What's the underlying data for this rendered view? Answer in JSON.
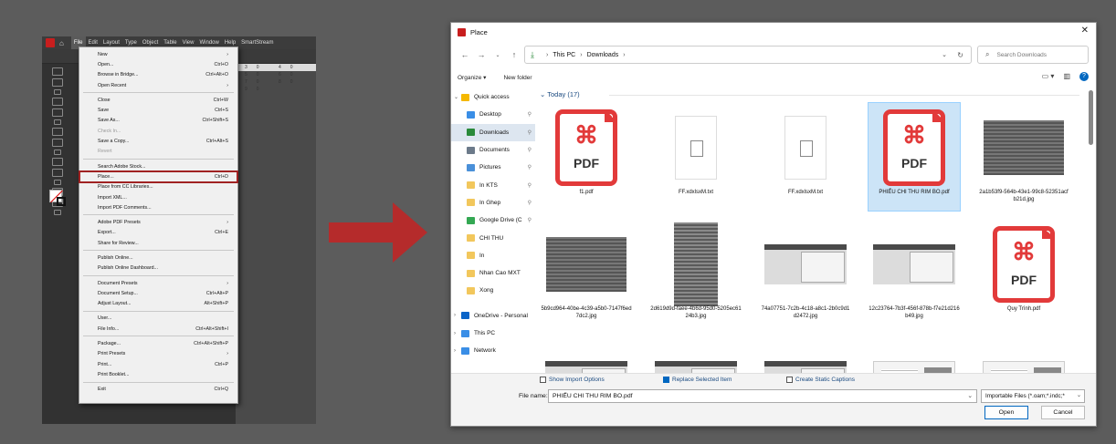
{
  "indesign": {
    "menubar": [
      "File",
      "Edit",
      "Layout",
      "Type",
      "Object",
      "Table",
      "View",
      "Window",
      "Help",
      "SmartStream"
    ],
    "ruler_ticks": "30 40 50 60 70 80 90",
    "file_menu": [
      {
        "label": "New",
        "shortcut": "",
        "sub": true
      },
      {
        "label": "Open...",
        "shortcut": "Ctrl+O"
      },
      {
        "label": "Browse in Bridge...",
        "shortcut": "Ctrl+Alt+O"
      },
      {
        "label": "Open Recent",
        "shortcut": "",
        "sub": true
      },
      {
        "sep": true
      },
      {
        "label": "Close",
        "shortcut": "Ctrl+W"
      },
      {
        "label": "Save",
        "shortcut": "Ctrl+S"
      },
      {
        "label": "Save As...",
        "shortcut": "Ctrl+Shift+S"
      },
      {
        "label": "Check In...",
        "shortcut": "",
        "disabled": true
      },
      {
        "label": "Save a Copy...",
        "shortcut": "Ctrl+Alt+S"
      },
      {
        "label": "Revert",
        "shortcut": "",
        "disabled": true
      },
      {
        "sep": true
      },
      {
        "label": "Search Adobe Stock...",
        "shortcut": ""
      },
      {
        "label": "Place...",
        "shortcut": "Ctrl+D",
        "highlight": true
      },
      {
        "label": "Place from CC Libraries...",
        "shortcut": ""
      },
      {
        "label": "Import XML...",
        "shortcut": ""
      },
      {
        "label": "Import PDF Comments...",
        "shortcut": ""
      },
      {
        "sep": true
      },
      {
        "label": "Adobe PDF Presets",
        "shortcut": "",
        "sub": true
      },
      {
        "label": "Export...",
        "shortcut": "Ctrl+E"
      },
      {
        "label": "Share for Review...",
        "shortcut": ""
      },
      {
        "sep": true
      },
      {
        "label": "Publish Online...",
        "shortcut": ""
      },
      {
        "label": "Publish Online Dashboard...",
        "shortcut": ""
      },
      {
        "sep": true
      },
      {
        "label": "Document Presets",
        "shortcut": "",
        "sub": true
      },
      {
        "label": "Document Setup...",
        "shortcut": "Ctrl+Alt+P"
      },
      {
        "label": "Adjust Layout...",
        "shortcut": "Alt+Shift+P"
      },
      {
        "sep": true
      },
      {
        "label": "User...",
        "shortcut": ""
      },
      {
        "label": "File Info...",
        "shortcut": "Ctrl+Alt+Shift+I"
      },
      {
        "sep": true
      },
      {
        "label": "Package...",
        "shortcut": "Ctrl+Alt+Shift+P"
      },
      {
        "label": "Print Presets",
        "shortcut": "",
        "sub": true
      },
      {
        "label": "Print...",
        "shortcut": "Ctrl+P"
      },
      {
        "label": "Print Booklet...",
        "shortcut": ""
      },
      {
        "sep": true
      },
      {
        "label": "Exit",
        "shortcut": "Ctrl+Q"
      }
    ]
  },
  "dialog": {
    "title": "Place",
    "breadcrumb": [
      "This PC",
      "Downloads"
    ],
    "search_placeholder": "Search Downloads",
    "organize": "Organize ▾",
    "new_folder": "New folder",
    "nav": [
      {
        "label": "Quick access",
        "icon": "star-icon",
        "expander": true,
        "pin": false
      },
      {
        "label": "Desktop",
        "icon": "desktop-icon",
        "pin": true
      },
      {
        "label": "Downloads",
        "icon": "download-icon",
        "pin": true,
        "selected": true
      },
      {
        "label": "Documents",
        "icon": "documents-icon",
        "pin": true
      },
      {
        "label": "Pictures",
        "icon": "pictures-icon",
        "pin": true
      },
      {
        "label": "In KTS",
        "icon": "folder-icon",
        "pin": true
      },
      {
        "label": "In Ghep",
        "icon": "folder-icon",
        "pin": true
      },
      {
        "label": "Google Drive (C",
        "icon": "drive-icon",
        "pin": true
      },
      {
        "label": "CHI THU",
        "icon": "folder-icon",
        "pin": false
      },
      {
        "label": "In",
        "icon": "folder-icon",
        "pin": false
      },
      {
        "label": "Nhan Cao MXT",
        "icon": "folder-icon",
        "pin": false
      },
      {
        "label": "Xong",
        "icon": "folder-icon",
        "pin": false
      },
      {
        "label": "OneDrive - Personal",
        "icon": "onedrive-icon",
        "expander": true
      },
      {
        "label": "This PC",
        "icon": "pc-icon",
        "expander": true
      },
      {
        "label": "Network",
        "icon": "network-icon",
        "expander": true
      }
    ],
    "group_header": "Today (17)",
    "files": [
      {
        "name": "f1.pdf",
        "kind": "pdf"
      },
      {
        "name": "FF.xdxlsxM.txt",
        "kind": "txt"
      },
      {
        "name": "FF.xdxlsxM.txt",
        "kind": "txt"
      },
      {
        "name": "PHIẾU CHI THU RIM BO.pdf",
        "kind": "pdf",
        "selected": true
      },
      {
        "name": "2a1b53f9-564b-43e1-99c8-52351acfb21d.jpg",
        "kind": "sheet"
      },
      {
        "name": "5b9cd964-40be-4c39-a5b0-7147f6ed7dc2.jpg",
        "kind": "sheet"
      },
      {
        "name": "2d619d9d-faee-4b6d-95d0-5205ec6124b3.jpg",
        "kind": "tall"
      },
      {
        "name": "74a07751-7c2b-4c18-a8c1-2b0c9d1d2472.jpg",
        "kind": "screen"
      },
      {
        "name": "12c23764-7b3f-456f-878b-f7e21d216b49.jpg",
        "kind": "screen"
      },
      {
        "name": "Quy Trình.pdf",
        "kind": "pdf"
      },
      {
        "name": "",
        "kind": "screen"
      },
      {
        "name": "",
        "kind": "screen"
      },
      {
        "name": "",
        "kind": "screen"
      },
      {
        "name": "",
        "kind": "white"
      },
      {
        "name": "",
        "kind": "white"
      }
    ],
    "options": {
      "show_import": "Show Import Options",
      "replace_selected": "Replace Selected Item",
      "create_static": "Create Static Captions"
    },
    "file_name_label": "File name:",
    "file_name_value": "PHIẾU CHI THU RIM BO.pdf",
    "file_type_value": "Importable Files (*.oam;*.indc;*",
    "open_label": "Open",
    "cancel_label": "Cancel",
    "pdf_label": "PDF"
  },
  "colors": {
    "accent": "#0067c0",
    "pdf_red": "#e23a3a",
    "arrow": "#b52b2b",
    "highlight": "#a02222"
  }
}
